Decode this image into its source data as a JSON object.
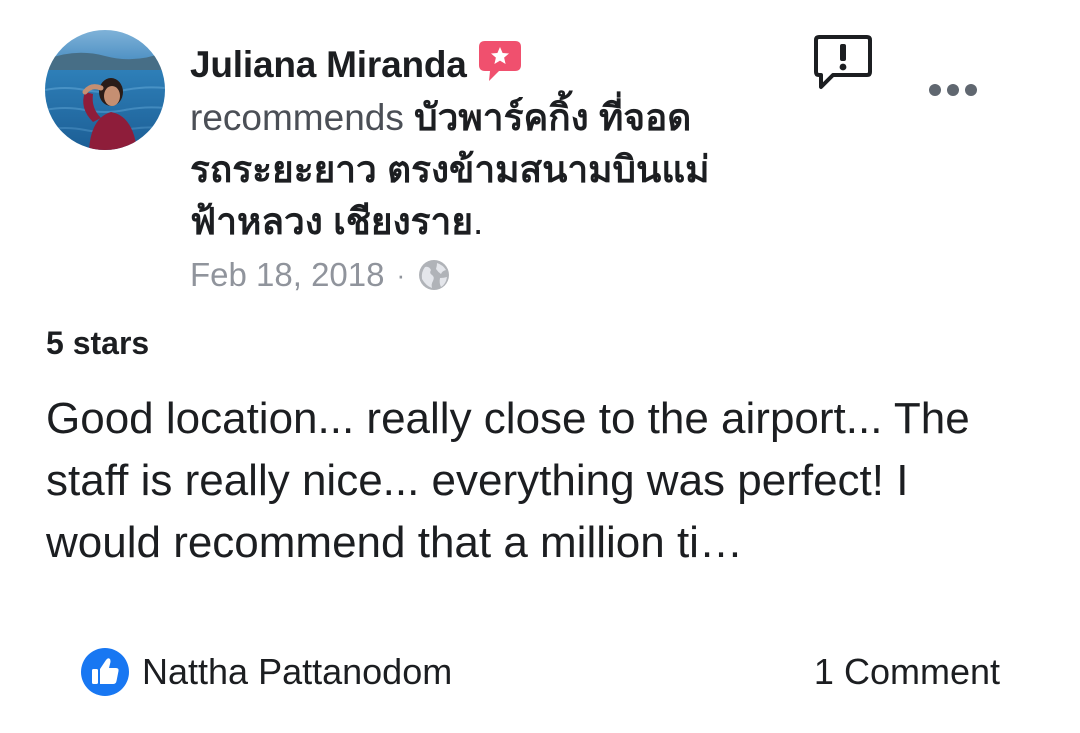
{
  "post": {
    "author_name": "Juliana Miranda",
    "verb": "recommends",
    "page_name": "บัวพาร์คกิ้ง ที่จอดรถระยะยาว ตรงข้ามสนามบินแม่ฟ้าหลวง เชียงราย",
    "page_line_1": "บัวพาร์คกิ้ง ที่จอด",
    "page_line_2": "รถระยะยาว ตรงข้ามสนามบินแม่",
    "page_line_3": "ฟ้าหลวง เชียงราย",
    "period": ".",
    "date": "Feb 18, 2018",
    "separator": "·",
    "privacy_icon": "globe-icon",
    "recommend_badge_icon": "star-speech-bubble-icon",
    "report_icon": "report-speech-bubble-icon",
    "more_icon": "more-horizontal-icon"
  },
  "review": {
    "rating_label": "5 stars",
    "text": "Good location... really close to the airport... The staff is really nice... everything was perfect! I would recommend that a million ti…"
  },
  "footer": {
    "reaction_icon": "like-thumb-icon",
    "reactor_name": "Nattha Pattanodom",
    "comment_count_label": "1 Comment"
  },
  "colors": {
    "text_primary": "#1c1e21",
    "text_secondary": "#90949c",
    "badge_pink": "#f0506e",
    "like_blue": "#1877f2",
    "icon_gray": "#606770"
  }
}
